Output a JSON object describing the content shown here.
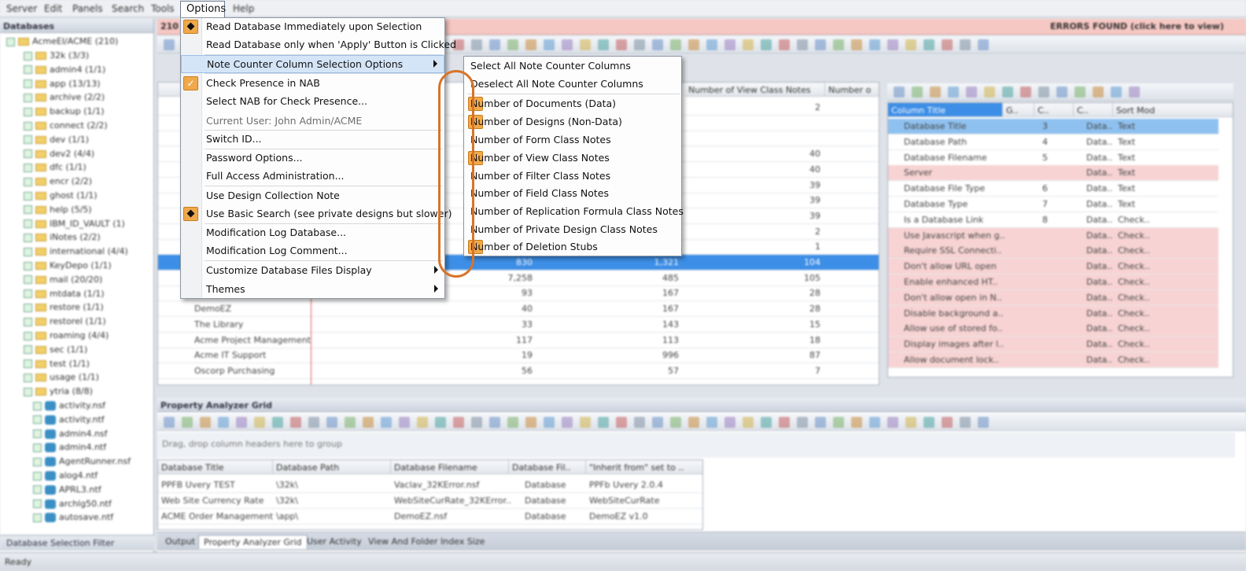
{
  "menubar": [
    "Server",
    "Edit",
    "Panels",
    "Search",
    "Tools",
    "Options",
    "Help"
  ],
  "error_bar": {
    "left": "210",
    "right": "ERRORS FOUND (click here to view)"
  },
  "databases_panel": {
    "title": "Databases",
    "root": "AcmeEI/ACME (210)",
    "folders": [
      "32k (3/3)",
      "admin4 (1/1)",
      "app (13/13)",
      "archive (2/2)",
      "backup (1/1)",
      "connect (2/2)",
      "dev (1/1)",
      "dev2 (4/4)",
      "dfc (1/1)",
      "encr (2/2)",
      "ghost (1/1)",
      "help (5/5)",
      "IBM_ID_VAULT (1)",
      "iNotes (2/2)",
      "international (4/4)",
      "KeyDepo (1/1)",
      "mail (20/20)",
      "mtdata (1/1)",
      "restore (1/1)",
      "restorel (1/1)",
      "roaming (4/4)",
      "sec (1/1)",
      "test (1/1)",
      "usage (1/1)",
      "ytria (8/8)"
    ],
    "files": [
      "activity.nsf",
      "activity.ntf",
      "admin4.nsf",
      "admin4.ntf",
      "AgentRunner.nsf",
      "alog4.ntf",
      "APRL3.ntf",
      "archlg50.ntf",
      "autosave.ntf"
    ],
    "filter_label": "Database Selection Filter"
  },
  "main_grid": {
    "col_view_notes": "Number of View Class Notes",
    "col_next": "Number o",
    "rows": [
      {
        "title": "",
        "a": "",
        "b": "",
        "c": "2"
      },
      {
        "title": "",
        "a": "",
        "b": "",
        "c": ""
      },
      {
        "title": "",
        "a": "",
        "b": "",
        "c": ""
      },
      {
        "title": "",
        "a": "",
        "b": "",
        "c": "40"
      },
      {
        "title": "",
        "a": "",
        "b": "",
        "c": "40"
      },
      {
        "title": "",
        "a": "",
        "b": "",
        "c": "39"
      },
      {
        "title": "",
        "a": "",
        "b": "",
        "c": "39"
      },
      {
        "title": "",
        "a": "",
        "b": "",
        "c": "39"
      },
      {
        "title": "",
        "a": "",
        "b": "",
        "c": "2"
      },
      {
        "title": "",
        "a": "",
        "b": "",
        "c": "1"
      },
      {
        "title": "",
        "a": "830",
        "b": "1,321",
        "c": "104"
      },
      {
        "title": "",
        "a": "7,258",
        "b": "485",
        "c": "105"
      },
      {
        "title": "",
        "a": "93",
        "b": "167",
        "c": "28"
      },
      {
        "title": "DemoEZ",
        "a": "40",
        "b": "167",
        "c": "28"
      },
      {
        "title": "The Library",
        "a": "33",
        "b": "143",
        "c": "15"
      },
      {
        "title": "Acme Project Management",
        "a": "117",
        "b": "113",
        "c": "18"
      },
      {
        "title": "Acme IT Support",
        "a": "19",
        "b": "996",
        "c": "87"
      },
      {
        "title": "Oscorp Purchasing",
        "a": "56",
        "b": "57",
        "c": "7"
      }
    ]
  },
  "column_grid": {
    "headers": [
      "Column Title",
      "G..",
      "C..",
      "C..",
      "Sort Mod"
    ],
    "rows": [
      {
        "title": "Database Title",
        "num": "3",
        "a": "Data..",
        "b": "Text",
        "style": "blue"
      },
      {
        "title": "Database Path",
        "num": "4",
        "a": "Data..",
        "b": "Text",
        "style": ""
      },
      {
        "title": "Database Filename",
        "num": "5",
        "a": "Data..",
        "b": "Text",
        "style": ""
      },
      {
        "title": "Server",
        "num": "",
        "a": "Data..",
        "b": "Text",
        "style": "pink"
      },
      {
        "title": "Database File Type",
        "num": "6",
        "a": "Data..",
        "b": "Text",
        "style": ""
      },
      {
        "title": "Database Type",
        "num": "7",
        "a": "Data..",
        "b": "Text",
        "style": ""
      },
      {
        "title": "Is a Database Link",
        "num": "8",
        "a": "Data..",
        "b": "Check..",
        "style": ""
      },
      {
        "title": "Use Javascript when g..",
        "num": "",
        "a": "Data..",
        "b": "Check..",
        "style": "pink"
      },
      {
        "title": "Require SSL Connecti..",
        "num": "",
        "a": "Data..",
        "b": "Check..",
        "style": "pink"
      },
      {
        "title": "Don't allow URL open",
        "num": "",
        "a": "Data..",
        "b": "Check..",
        "style": "pink"
      },
      {
        "title": "Enable enhanced HT..",
        "num": "",
        "a": "Data..",
        "b": "Check..",
        "style": "pink"
      },
      {
        "title": "Don't allow open in N..",
        "num": "",
        "a": "Data..",
        "b": "Check..",
        "style": "pink"
      },
      {
        "title": "Disable background a..",
        "num": "",
        "a": "Data..",
        "b": "Check..",
        "style": "pink"
      },
      {
        "title": "Allow use of stored fo..",
        "num": "",
        "a": "Data..",
        "b": "Check..",
        "style": "pink"
      },
      {
        "title": "Display images after l..",
        "num": "",
        "a": "Data..",
        "b": "Check..",
        "style": "pink"
      },
      {
        "title": "Allow document lock..",
        "num": "",
        "a": "Data..",
        "b": "Check..",
        "style": "pink"
      }
    ]
  },
  "property_panel": {
    "title": "Property Analyzer Grid",
    "group_hint": "Drag, drop column headers here to group",
    "headers": [
      "Database Title",
      "Database Path",
      "Database Filename",
      "Database Fil..",
      "\"Inherit from\" set to .."
    ],
    "rows": [
      [
        "PPFB Uvery TEST",
        "\\32k\\",
        "Vaclav_32KError.nsf",
        "Database",
        "PPFb Uvery 2.0.4"
      ],
      [
        "Web Site Currency Rate",
        "\\32k\\",
        "WebSiteCurRate_32KError..",
        "Database",
        "WebSiteCurRate"
      ],
      [
        "ACME Order Management",
        "\\app\\",
        "DemoEZ.nsf",
        "Database",
        "DemoEZ v1.0"
      ]
    ]
  },
  "bottom_tabs": [
    "Output",
    "Property Analyzer Grid",
    "User Activity",
    "View And Folder Index Size"
  ],
  "status": "Ready",
  "options_menu": {
    "title": "Options",
    "items": [
      {
        "label": "Read Database Immediately upon Selection",
        "mark": "dot"
      },
      {
        "label": "Read Database only when 'Apply' Button is Clicked",
        "mark": ""
      },
      {
        "label": "Note Counter Column Selection Options",
        "mark": "",
        "submenu": true,
        "highlight": true
      },
      {
        "label": "Check Presence in NAB",
        "mark": "check"
      },
      {
        "label": "Select NAB for Check Presence...",
        "mark": ""
      },
      {
        "label": "Current User: John Admin/ACME",
        "mark": "",
        "disabled": true
      },
      {
        "label": "Switch ID...",
        "mark": ""
      },
      {
        "label": "Password Options...",
        "mark": ""
      },
      {
        "label": "Full Access Administration...",
        "mark": ""
      },
      {
        "label": "Use Design Collection Note",
        "mark": ""
      },
      {
        "label": "Use Basic Search (see private designs but slower)",
        "mark": "dot"
      },
      {
        "label": "Modification Log Database...",
        "mark": ""
      },
      {
        "label": "Modification Log Comment...",
        "mark": ""
      },
      {
        "label": "Customize Database Files Display",
        "mark": "",
        "submenu": true
      },
      {
        "label": "Themes",
        "mark": "",
        "submenu": true
      }
    ]
  },
  "note_counter_submenu": {
    "items": [
      {
        "label": "Select All Note Counter Columns",
        "checked": false
      },
      {
        "label": "Deselect All Note Counter Columns",
        "checked": false
      },
      {
        "label": "Number of Documents (Data)",
        "checked": true
      },
      {
        "label": "Number of Designs (Non-Data)",
        "checked": true
      },
      {
        "label": "Number of Form Class Notes",
        "checked": false
      },
      {
        "label": "Number of View Class Notes",
        "checked": true
      },
      {
        "label": "Number of Filter Class Notes",
        "checked": false
      },
      {
        "label": "Number of Field Class Notes",
        "checked": false
      },
      {
        "label": "Number of Replication Formula Class Notes",
        "checked": false
      },
      {
        "label": "Number of Private Design Class Notes",
        "checked": false
      },
      {
        "label": "Number of Deletion Stubs",
        "checked": true
      }
    ]
  },
  "colors": {
    "accent_orange": "#f0a94a",
    "callout": "#d8742a",
    "error_pink": "#f6c8c4",
    "selection_blue": "#3d8ee6"
  }
}
